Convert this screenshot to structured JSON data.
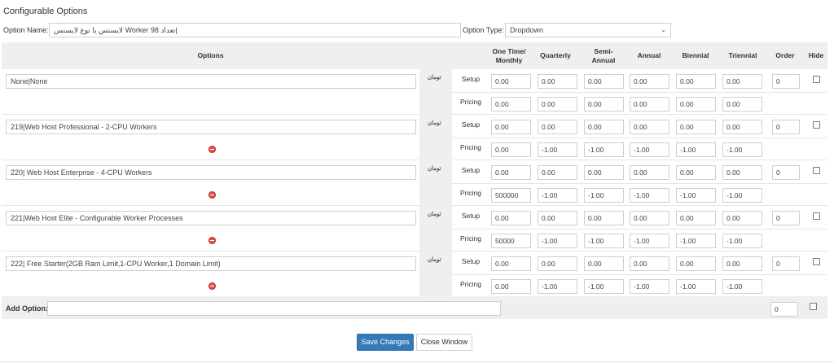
{
  "page": {
    "title": "Configurable Options",
    "option_name_label": "Option Name:",
    "option_name_value": "لایسنس یا نوع لایسنس Worker تعداد 98|",
    "option_type_label": "Option Type:",
    "option_type_value": "Dropdown"
  },
  "headers": {
    "options": "Options",
    "onetime": "One Time/ Monthly",
    "quarterly": "Quarterly",
    "semiannual": "Semi- Annual",
    "annual": "Annual",
    "biennial": "Biennial",
    "triennial": "Triennial",
    "order": "Order",
    "hide": "Hide"
  },
  "row_labels": {
    "setup": "Setup",
    "pricing": "Pricing"
  },
  "currency": "تومان",
  "options": [
    {
      "name": "None|None",
      "setup": [
        "0.00",
        "0.00",
        "0.00",
        "0.00",
        "0.00",
        "0.00"
      ],
      "pricing": [
        "0.00",
        "0.00",
        "0.00",
        "0.00",
        "0.00",
        "0.00"
      ],
      "order": "0",
      "hide": false,
      "deletable": false
    },
    {
      "name": "219|Web Host Professional - 2-CPU Workers",
      "setup": [
        "0.00",
        "0.00",
        "0.00",
        "0.00",
        "0.00",
        "0.00"
      ],
      "pricing": [
        "0.00",
        "-1.00",
        "-1.00",
        "-1.00",
        "-1.00",
        "-1.00"
      ],
      "order": "0",
      "hide": false,
      "deletable": true
    },
    {
      "name": "220| Web Host Enterprise - 4-CPU Workers",
      "setup": [
        "0.00",
        "0.00",
        "0.00",
        "0.00",
        "0.00",
        "0.00"
      ],
      "pricing": [
        "500000",
        "-1.00",
        "-1.00",
        "-1.00",
        "-1.00",
        "-1.00"
      ],
      "order": "0",
      "hide": false,
      "deletable": true
    },
    {
      "name": "221|Web Host Elite - Configurable Worker Processes",
      "setup": [
        "0.00",
        "0.00",
        "0.00",
        "0.00",
        "0.00",
        "0.00"
      ],
      "pricing": [
        "50000",
        "-1.00",
        "-1.00",
        "-1.00",
        "-1.00",
        "-1.00"
      ],
      "order": "0",
      "hide": false,
      "deletable": true
    },
    {
      "name": "222| Free Starter(2GB Ram Limit,1-CPU Worker,1 Domain Limit)",
      "setup": [
        "0.00",
        "0.00",
        "0.00",
        "0.00",
        "0.00",
        "0.00"
      ],
      "pricing": [
        "0.00",
        "-1.00",
        "-1.00",
        "-1.00",
        "-1.00",
        "-1.00"
      ],
      "order": "0",
      "hide": false,
      "deletable": true
    }
  ],
  "add_option": {
    "label": "Add Option:",
    "value": "",
    "order": "0"
  },
  "buttons": {
    "save": "Save Changes",
    "close": "Close Window"
  },
  "colors": {
    "primary": "#337ab7",
    "danger": "#d9534f",
    "header_bg": "#efefef"
  }
}
